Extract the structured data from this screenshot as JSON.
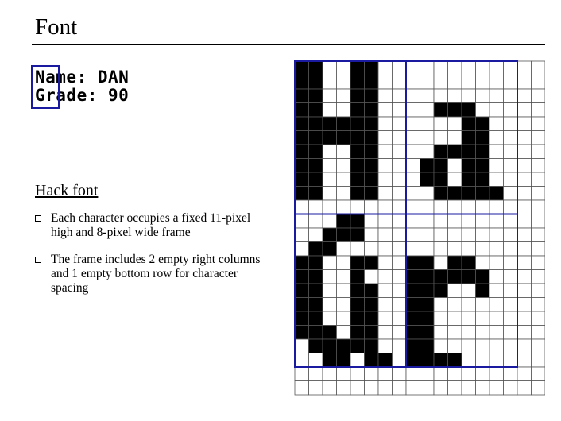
{
  "slide": {
    "title": "Font",
    "screen_lines": [
      "Name: DAN",
      "Grade: 90"
    ],
    "section_heading": "Hack font",
    "bullets": [
      "Each character occupies a fixed 11-pixel high and 8-pixel wide frame",
      "The frame includes 2 empty right columns and 1 empty bottom row for character spacing"
    ]
  },
  "pixel_grid": {
    "cols": 18,
    "rows": 24,
    "colors": {
      "on": "#000000",
      "off": "#ffffff",
      "grid_line": "#555555",
      "frame": "#1a1aa0"
    },
    "glyphs": [
      {
        "char": "N",
        "bitmap": [
          "11001100",
          "11001100",
          "11001100",
          "11001100",
          "11111100",
          "11111100",
          "11001100",
          "11001100",
          "11001100",
          "11001100",
          "00000000"
        ]
      },
      {
        "char": "a",
        "bitmap": [
          "00000000",
          "00000000",
          "00000000",
          "00111000",
          "00001100",
          "00001100",
          "00111100",
          "01101100",
          "01101100",
          "00111110",
          "00000000"
        ]
      },
      {
        "char": "G",
        "bitmap": [
          "00011000",
          "00111000",
          "01100000",
          "11001100",
          "11001000",
          "11001100",
          "11001100",
          "11001100",
          "11101100",
          "01111100",
          "00110110"
        ]
      },
      {
        "char": "r",
        "bitmap": [
          "00000000",
          "00000000",
          "00000000",
          "11011000",
          "11111100",
          "11100100",
          "11000000",
          "11000000",
          "11000000",
          "11000000",
          "11110000"
        ]
      }
    ]
  }
}
